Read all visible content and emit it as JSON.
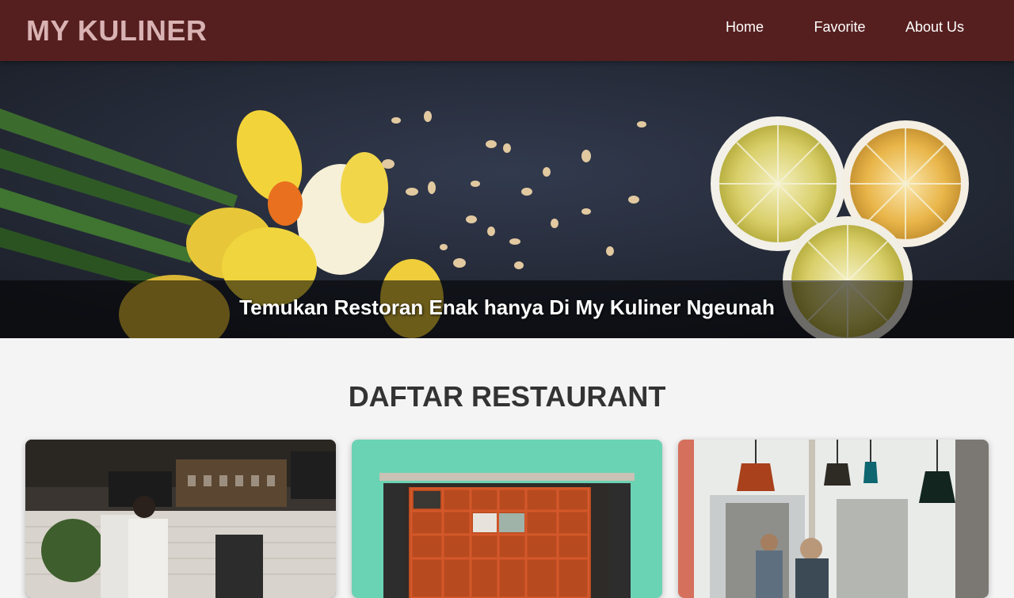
{
  "header": {
    "brand": "MY KULINER",
    "nav": [
      {
        "label": "Home"
      },
      {
        "label": "Favorite"
      },
      {
        "label": "About Us"
      }
    ]
  },
  "hero": {
    "caption": "Temukan Restoran Enak hanya Di My Kuliner Ngeunah"
  },
  "main": {
    "title": "DAFTAR RESTAURANT"
  },
  "colors": {
    "header_bg": "#561f1f",
    "brand_text": "#d9b3b3",
    "page_bg": "#f4f4f4"
  }
}
